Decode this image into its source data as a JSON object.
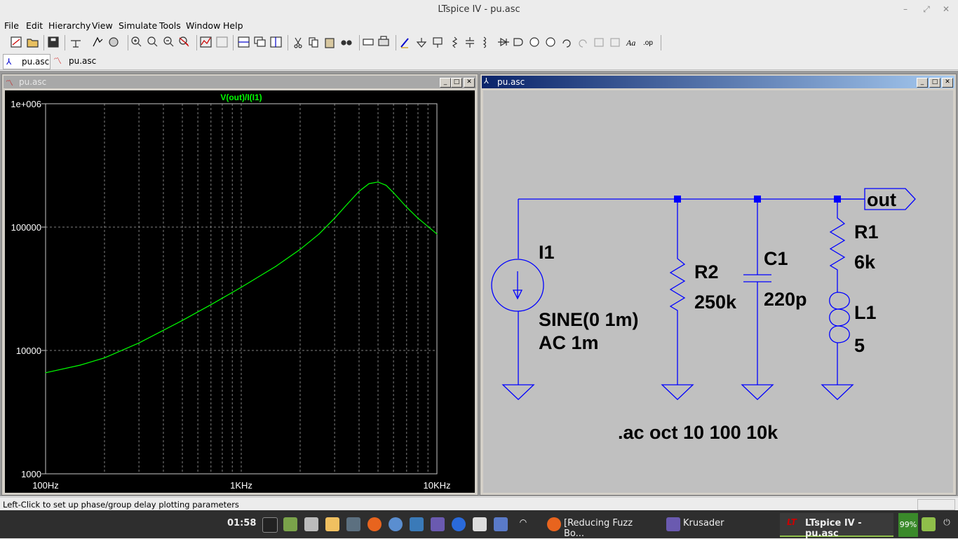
{
  "window": {
    "title": "LTspice IV - pu.asc"
  },
  "menu": [
    "File",
    "Edit",
    "Hierarchy",
    "View",
    "Simulate",
    "Tools",
    "Window",
    "Help"
  ],
  "tabs": [
    {
      "label": "pu.asc",
      "icon": "schematic-icon"
    },
    {
      "label": "pu.asc",
      "icon": "waveform-icon"
    }
  ],
  "plot_window": {
    "title": "pu.asc",
    "trace_label": "V(out)/I(I1)",
    "trace_color": "#00ff00",
    "y_ticks": [
      "1e+006",
      "100000",
      "10000",
      "1000"
    ],
    "x_ticks": [
      "100Hz",
      "1KHz",
      "10KHz"
    ]
  },
  "chart_data": {
    "type": "line",
    "title": "V(out)/I(I1)",
    "xscale": "log",
    "yscale": "log",
    "xlim": [
      100,
      10000
    ],
    "ylim": [
      1000,
      1000000
    ],
    "grid": true,
    "series": [
      {
        "name": "V(out)/I(I1)",
        "x": [
          100,
          150,
          200,
          300,
          500,
          700,
          1000,
          1500,
          2000,
          2500,
          3000,
          3500,
          4000,
          4500,
          5000,
          5500,
          6000,
          7000,
          8000,
          10000
        ],
        "y": [
          6600,
          7600,
          8700,
          11500,
          17500,
          23500,
          32500,
          48000,
          66000,
          88000,
          118000,
          155000,
          195000,
          225000,
          232000,
          218000,
          190000,
          145000,
          118000,
          88000
        ]
      }
    ]
  },
  "schematic_window": {
    "title": "pu.asc",
    "labels": {
      "i1_name": "I1",
      "i1_value1": "SINE(0 1m)",
      "i1_value2": "AC 1m",
      "r2_name": "R2",
      "r2_value": "250k",
      "c1_name": "C1",
      "c1_value": "220p",
      "r1_name": "R1",
      "r1_value": "6k",
      "l1_name": "L1",
      "l1_value": "5",
      "net_label": "out",
      "directive": ".ac oct 10 100 10k"
    },
    "wire_color": "#0000ff",
    "background": "#c0c0c0"
  },
  "status": {
    "text": "Left-Click to set up phase/group delay plotting parameters"
  },
  "taskbar": {
    "clock": "01:58",
    "tasks": [
      {
        "label": "[Reducing Fuzz Bo..."
      },
      {
        "label": "Krusader"
      },
      {
        "label": "LTspice IV - pu.asc"
      }
    ],
    "battery": "99%"
  }
}
